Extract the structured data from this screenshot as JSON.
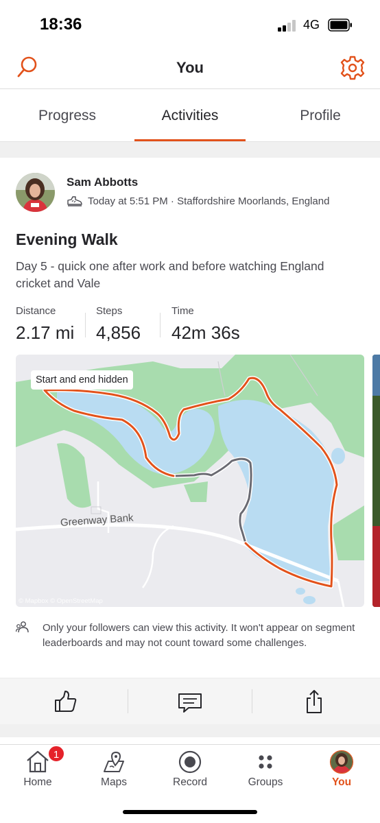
{
  "status_bar": {
    "time": "18:36",
    "network": "4G"
  },
  "header": {
    "title": "You"
  },
  "tabs": [
    {
      "label": "Progress",
      "active": false
    },
    {
      "label": "Activities",
      "active": true
    },
    {
      "label": "Profile",
      "active": false
    }
  ],
  "activity": {
    "athlete_name": "Sam Abbotts",
    "meta": "Today at 5:51 PM · Staffordshire Moorlands, England",
    "title": "Evening Walk",
    "description": "Day 5 - quick one after work and before watching England cricket and Vale",
    "stats": [
      {
        "label": "Distance",
        "value": "2.17 mi"
      },
      {
        "label": "Steps",
        "value": "4,856"
      },
      {
        "label": "Time",
        "value": "42m 36s"
      }
    ],
    "map": {
      "hidden_badge": "Start and end hidden",
      "road_label": "Greenway Bank",
      "attribution": "© Mapbox © OpenStreetMap"
    },
    "privacy_note": "Only your followers can view this activity. It won't appear on segment leaderboards and may not count toward some challenges."
  },
  "actions": [
    {
      "name": "kudos",
      "icon": "thumbs-up-icon"
    },
    {
      "name": "comment",
      "icon": "comment-icon"
    },
    {
      "name": "share",
      "icon": "share-icon"
    }
  ],
  "tabbar": {
    "items": [
      {
        "label": "Home",
        "icon": "home-icon",
        "badge": "1"
      },
      {
        "label": "Maps",
        "icon": "maps-icon"
      },
      {
        "label": "Record",
        "icon": "record-icon"
      },
      {
        "label": "Groups",
        "icon": "groups-icon"
      },
      {
        "label": "You",
        "icon": "avatar",
        "active": true
      }
    ]
  },
  "colors": {
    "accent": "#e2521b",
    "route": "#e2521b",
    "water": "#b9dcf2",
    "park": "#a8dcae"
  }
}
